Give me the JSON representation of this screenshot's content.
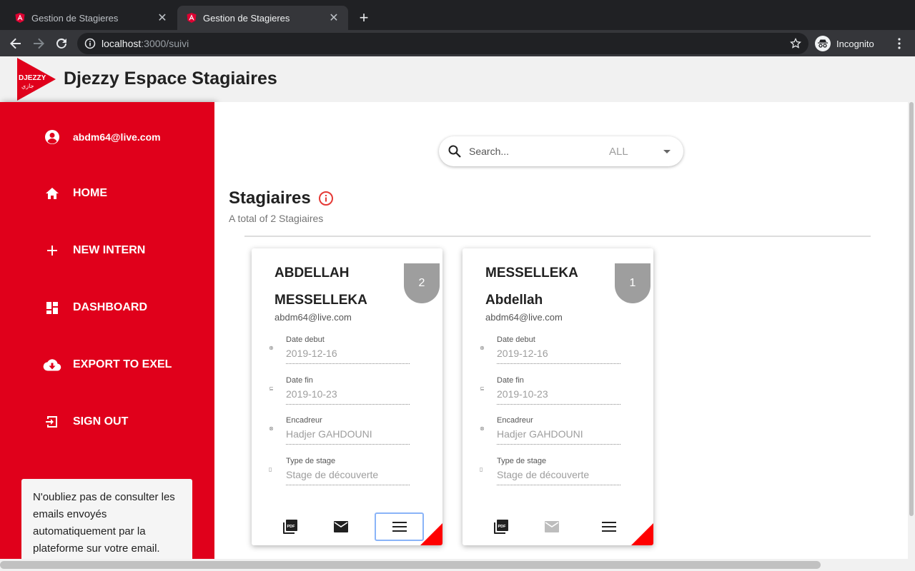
{
  "browser": {
    "tabs": [
      {
        "title": "Gestion de Stagieres",
        "active": false
      },
      {
        "title": "Gestion de Stagieres",
        "active": true
      }
    ],
    "url_host": "localhost",
    "url_path": ":3000/suivi",
    "incognito_label": "Incognito"
  },
  "header": {
    "logo_text": "DJEZZY",
    "logo_subtext": "جازي",
    "title": "Djezzy Espace Stagiaires"
  },
  "sidebar": {
    "user_email": "abdm64@live.com",
    "items": [
      {
        "label": "HOME",
        "icon": "home-icon"
      },
      {
        "label": "NEW INTERN",
        "icon": "plus-icon"
      },
      {
        "label": "DASHBOARD",
        "icon": "dashboard-icon"
      },
      {
        "label": "EXPORT TO EXEL",
        "icon": "cloud-download-icon"
      },
      {
        "label": "SIGN OUT",
        "icon": "exit-icon"
      }
    ],
    "note": "N'oubliez pas de consulter les emails envoyés automatiquement par la plateforme sur votre email."
  },
  "search": {
    "placeholder": "Search...",
    "filter_value": "ALL"
  },
  "main": {
    "title": "Stagiaires",
    "subtitle": "A total of 2 Stagiaires"
  },
  "field_labels": {
    "start": "Date debut",
    "end": "Date fin",
    "supervisor": "Encadreur",
    "type": "Type de stage"
  },
  "cards": [
    {
      "name_line1": "ABDELLAH",
      "name_line2": "MESSELLEKA",
      "badge": "2",
      "email": "abdm64@live.com",
      "date_debut": "2019-12-16",
      "date_fin": "2019-10-23",
      "encadreur": "Hadjer GAHDOUNI",
      "type_stage": "Stage de découverte"
    },
    {
      "name_line1": "MESSELLEKA",
      "name_line2": "Abdellah",
      "badge": "1",
      "email": "abdm64@live.com",
      "date_debut": "2019-12-16",
      "date_fin": "2019-10-23",
      "encadreur": "Hadjer GAHDOUNI",
      "type_stage": "Stage de découverte"
    }
  ],
  "colors": {
    "brand_red": "#e0001b",
    "badge_gray": "#9e9e9e",
    "focus_blue": "#8ab4f8"
  }
}
